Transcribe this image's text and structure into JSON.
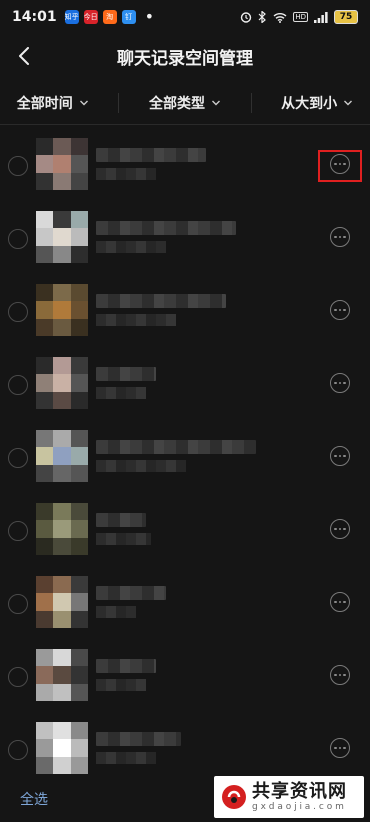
{
  "status_bar": {
    "time": "14:01",
    "apps": [
      {
        "label": "知乎",
        "color": "#1a6fe0"
      },
      {
        "label": "今日",
        "color": "#d8232a"
      },
      {
        "label": "淘",
        "color": "#ff6a1a"
      },
      {
        "label": "钉",
        "color": "#2e8ff0"
      }
    ],
    "dot": "•",
    "battery": "75",
    "signal_text": "HD"
  },
  "navbar": {
    "title": "聊天记录空间管理"
  },
  "filters": [
    {
      "label": "全部时间"
    },
    {
      "label": "全部类型"
    },
    {
      "label": "从大到小"
    }
  ],
  "rows": [
    {
      "name_w": 110,
      "size_w": 60,
      "highlighted": true,
      "colors": [
        "#2a2a2a",
        "#6b5a55",
        "#3d3434",
        "#a58a85",
        "#b08070",
        "#555",
        "#323232",
        "#8a7a74",
        "#444"
      ]
    },
    {
      "name_w": 140,
      "size_w": 70,
      "highlighted": false,
      "colors": [
        "#d9d9d9",
        "#3a3a3a",
        "#9aa",
        "#c7c7c7",
        "#e0d9cf",
        "#bbb",
        "#555",
        "#888",
        "#2d2d2d"
      ]
    },
    {
      "name_w": 130,
      "size_w": 80,
      "highlighted": false,
      "colors": [
        "#3a3020",
        "#7c6a4a",
        "#5a4a30",
        "#8a6a3a",
        "#b07a3a",
        "#6a5030",
        "#4a3a28",
        "#6a5a40",
        "#3a3020"
      ]
    },
    {
      "name_w": 60,
      "size_w": 50,
      "highlighted": false,
      "colors": [
        "#2a2a2a",
        "#b39a95",
        "#3a3a3a",
        "#8f8077",
        "#c9b1a5",
        "#555",
        "#333",
        "#5a4a44",
        "#2a2a2a"
      ]
    },
    {
      "name_w": 160,
      "size_w": 90,
      "highlighted": false,
      "colors": [
        "#777",
        "#aaa",
        "#555",
        "#c8c4a0",
        "#8fa0c0",
        "#9aa",
        "#444",
        "#666",
        "#555"
      ]
    },
    {
      "name_w": 50,
      "size_w": 55,
      "highlighted": false,
      "colors": [
        "#3a3a2a",
        "#7a7a5a",
        "#4a4a3a",
        "#5a5a40",
        "#9a9a7a",
        "#6a6a50",
        "#2a2a20",
        "#4a4a3a",
        "#3a3a2a"
      ]
    },
    {
      "name_w": 70,
      "size_w": 40,
      "highlighted": false,
      "colors": [
        "#5a4030",
        "#8a6a50",
        "#3a3a3a",
        "#a0704a",
        "#d0c8b0",
        "#777",
        "#4a3a30",
        "#9a9070",
        "#333"
      ]
    },
    {
      "name_w": 60,
      "size_w": 50,
      "highlighted": false,
      "colors": [
        "#9a9a9a",
        "#d8d8d8",
        "#4a4a4a",
        "#8a6a5a",
        "#5a4a40",
        "#333",
        "#aaa",
        "#c0c0c0",
        "#555"
      ]
    },
    {
      "name_w": 85,
      "size_w": 60,
      "highlighted": false,
      "colors": [
        "#c0c0c0",
        "#e0e0e0",
        "#8a8a8a",
        "#9a9a9a",
        "#ffffff",
        "#bbb",
        "#6a6a6a",
        "#d0d0d0",
        "#999"
      ]
    }
  ],
  "footer": {
    "select_all": "全选"
  },
  "watermark": {
    "cn": "共享资讯网",
    "en": "g x d a o j i a . c o m"
  }
}
